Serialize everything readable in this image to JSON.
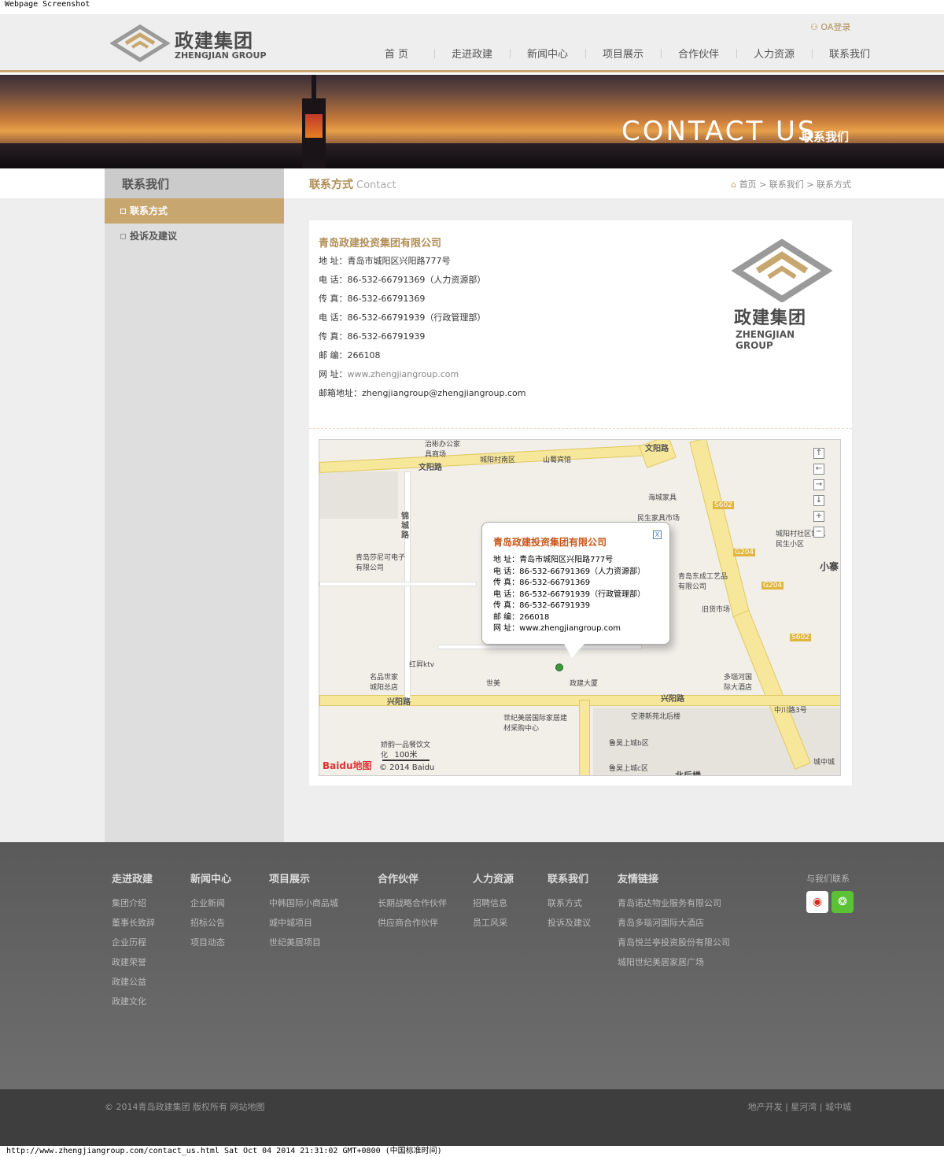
{
  "capture": {
    "top_label": "Webpage Screenshot",
    "bottom_label": "http://www.zhengjiangroup.com/contact_us.html Sat Oct 04 2014 21:31:02 GMT+0800 (中国标准时间)"
  },
  "header": {
    "logo_cn": "政建集团",
    "logo_en": "ZHENGJIAN GROUP",
    "oa_login": "OA登录",
    "nav": [
      "首 页",
      "走进政建",
      "新闻中心",
      "项目展示",
      "合作伙伴",
      "人力资源",
      "联系我们"
    ]
  },
  "banner": {
    "title": "CONTACT US",
    "subtitle": "联系我们"
  },
  "sidebar": {
    "title": "联系我们",
    "items": [
      {
        "label": "联系方式",
        "active": true
      },
      {
        "label": "投诉及建议",
        "active": false
      }
    ]
  },
  "main": {
    "title": "联系方式",
    "title_en": "Contact",
    "breadcrumb": [
      "首页",
      "联系我们",
      "联系方式"
    ]
  },
  "contact": {
    "company": "青岛政建投资集团有限公司",
    "rows": [
      {
        "label": "地 址：",
        "value": "青岛市城阳区兴阳路777号"
      },
      {
        "label": "电 话：",
        "value": "86-532-66791369（人力资源部）"
      },
      {
        "label": "传 真：",
        "value": "86-532-66791369"
      },
      {
        "label": "电 话：",
        "value": "86-532-66791939（行政管理部）"
      },
      {
        "label": "传 真：",
        "value": "86-532-66791939"
      },
      {
        "label": "邮 编：",
        "value": "266108"
      },
      {
        "label": "网 址：",
        "value": "www.zhengjiangroup.com"
      },
      {
        "label": "邮箱地址：",
        "value": "zhengjiangroup@zhengjiangroup.com"
      }
    ],
    "logo_cn": "政建集团",
    "logo_en": "ZHENGJIAN GROUP"
  },
  "map": {
    "popup": {
      "title": "青岛政建投资集团有限公司",
      "rows": [
        "地 址：青岛市城阳区兴阳路777号",
        "电 话：86-532-66791369（人力资源部）",
        "传 真：86-532-66791369",
        "电 话：86-532-66791939（行政管理部）",
        "传 真：86-532-66791939",
        "邮 编：266018",
        "网 址：www.zhengjiangroup.com"
      ],
      "close": "X"
    },
    "roads": [
      "文阳路",
      "文阳路",
      "兴阳路",
      "兴阳路",
      "锦城路"
    ],
    "places": [
      "治彬办公家具商场",
      "城阳村南区",
      "山蜀宾馆",
      "海城家具",
      "民生家具市场",
      "城阳村社区世纪民生小区",
      "青岛莎尼可电子有限公司",
      "青岛东成工艺品有限公司",
      "旧货市场",
      "红昇ktv",
      "名品世家城阳总店",
      "世美",
      "政建大厦",
      "多瑙河国际大酒店",
      "世纪美居国际家居建材采购中心",
      "空港新苑北后楼",
      "中川路3号",
      "娇韵一品餐饮文化",
      "鲁昊上城b区",
      "鲁昊上城c区",
      "城中城",
      "小寨",
      "北后楼"
    ],
    "highway_tags": [
      "S602",
      "G204",
      "G204",
      "S602"
    ],
    "scale": "100米",
    "brand": "Baidu地图",
    "copyright": "© 2014 Baidu",
    "zoom_controls": [
      "↑",
      "←",
      "→",
      "↓",
      "+",
      "−"
    ]
  },
  "footer": {
    "columns": [
      {
        "title": "走进政建",
        "items": [
          "集团介绍",
          "董事长致辞",
          "企业历程",
          "政建荣誉",
          "政建公益",
          "政建文化"
        ]
      },
      {
        "title": "新闻中心",
        "items": [
          "企业新闻",
          "招标公告",
          "项目动态"
        ]
      },
      {
        "title": "项目展示",
        "items": [
          "中韩国际小商品城",
          "城中城项目",
          "世纪美居项目"
        ]
      },
      {
        "title": "合作伙伴",
        "items": [
          "长期战略合作伙伴",
          "供应商合作伙伴"
        ]
      },
      {
        "title": "人力资源",
        "items": [
          "招聘信息",
          "员工风采"
        ]
      },
      {
        "title": "联系我们",
        "items": [
          "联系方式",
          "投诉及建议"
        ]
      },
      {
        "title": "友情链接",
        "items": [
          "青岛诺达物业服务有限公司",
          "青岛多瑙河国际大酒店",
          "青岛悦兰亭投资股份有限公司",
          "城阳世纪美居家居广场"
        ]
      }
    ],
    "contact_label": "与我们联系",
    "icons": [
      "weibo-icon",
      "wechat-icon"
    ],
    "copyright": "© 2014青岛政建集团 版权所有  网站地图",
    "links": "地产开发 | 星河湾 | 城中城"
  },
  "colors": {
    "accent": "#c8a66f",
    "accent_text": "#b08d55",
    "footer_bg": "#5a5a5a",
    "bottombar_bg": "#3e3e3e"
  }
}
